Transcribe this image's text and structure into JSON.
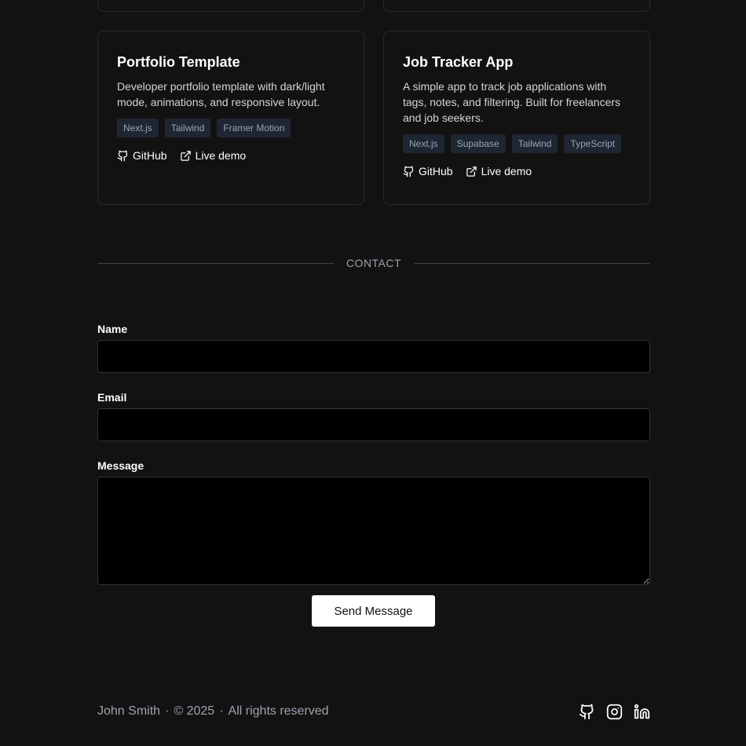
{
  "projects": [
    {
      "title": "Portfolio Template",
      "description": "Developer portfolio template with dark/light mode, animations, and responsive layout.",
      "tags": [
        "Next.js",
        "Tailwind",
        "Framer Motion"
      ],
      "github_label": "GitHub",
      "demo_label": "Live demo"
    },
    {
      "title": "Job Tracker App",
      "description": "A simple app to track job applications with tags, notes, and filtering. Built for freelancers and job seekers.",
      "tags": [
        "Next.js",
        "Supabase",
        "Tailwind",
        "TypeScript"
      ],
      "github_label": "GitHub",
      "demo_label": "Live demo"
    }
  ],
  "contact": {
    "section_label": "CONTACT",
    "name_label": "Name",
    "name_value": "",
    "email_label": "Email",
    "email_value": "",
    "message_label": "Message",
    "message_value": "",
    "submit_label": "Send Message"
  },
  "footer": {
    "name": "John Smith",
    "separator": "·",
    "copyright": "© 2025",
    "rights": "All rights reserved",
    "socials": [
      "github-icon",
      "instagram-icon",
      "linkedin-icon"
    ]
  },
  "colors": {
    "background": "#121212",
    "card_border": "#26292f",
    "tag_bg": "#1f2633",
    "input_bg": "#000000",
    "button_bg": "#ffffff",
    "muted_text": "#9ca3af"
  }
}
